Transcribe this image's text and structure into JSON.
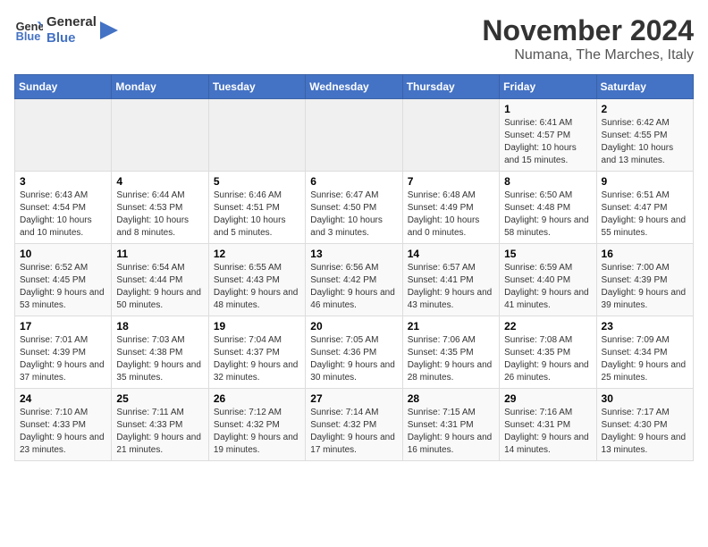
{
  "logo": {
    "line1": "General",
    "line2": "Blue"
  },
  "title": "November 2024",
  "location": "Numana, The Marches, Italy",
  "weekdays": [
    "Sunday",
    "Monday",
    "Tuesday",
    "Wednesday",
    "Thursday",
    "Friday",
    "Saturday"
  ],
  "weeks": [
    [
      {
        "day": "",
        "info": ""
      },
      {
        "day": "",
        "info": ""
      },
      {
        "day": "",
        "info": ""
      },
      {
        "day": "",
        "info": ""
      },
      {
        "day": "",
        "info": ""
      },
      {
        "day": "1",
        "info": "Sunrise: 6:41 AM\nSunset: 4:57 PM\nDaylight: 10 hours and 15 minutes."
      },
      {
        "day": "2",
        "info": "Sunrise: 6:42 AM\nSunset: 4:55 PM\nDaylight: 10 hours and 13 minutes."
      }
    ],
    [
      {
        "day": "3",
        "info": "Sunrise: 6:43 AM\nSunset: 4:54 PM\nDaylight: 10 hours and 10 minutes."
      },
      {
        "day": "4",
        "info": "Sunrise: 6:44 AM\nSunset: 4:53 PM\nDaylight: 10 hours and 8 minutes."
      },
      {
        "day": "5",
        "info": "Sunrise: 6:46 AM\nSunset: 4:51 PM\nDaylight: 10 hours and 5 minutes."
      },
      {
        "day": "6",
        "info": "Sunrise: 6:47 AM\nSunset: 4:50 PM\nDaylight: 10 hours and 3 minutes."
      },
      {
        "day": "7",
        "info": "Sunrise: 6:48 AM\nSunset: 4:49 PM\nDaylight: 10 hours and 0 minutes."
      },
      {
        "day": "8",
        "info": "Sunrise: 6:50 AM\nSunset: 4:48 PM\nDaylight: 9 hours and 58 minutes."
      },
      {
        "day": "9",
        "info": "Sunrise: 6:51 AM\nSunset: 4:47 PM\nDaylight: 9 hours and 55 minutes."
      }
    ],
    [
      {
        "day": "10",
        "info": "Sunrise: 6:52 AM\nSunset: 4:45 PM\nDaylight: 9 hours and 53 minutes."
      },
      {
        "day": "11",
        "info": "Sunrise: 6:54 AM\nSunset: 4:44 PM\nDaylight: 9 hours and 50 minutes."
      },
      {
        "day": "12",
        "info": "Sunrise: 6:55 AM\nSunset: 4:43 PM\nDaylight: 9 hours and 48 minutes."
      },
      {
        "day": "13",
        "info": "Sunrise: 6:56 AM\nSunset: 4:42 PM\nDaylight: 9 hours and 46 minutes."
      },
      {
        "day": "14",
        "info": "Sunrise: 6:57 AM\nSunset: 4:41 PM\nDaylight: 9 hours and 43 minutes."
      },
      {
        "day": "15",
        "info": "Sunrise: 6:59 AM\nSunset: 4:40 PM\nDaylight: 9 hours and 41 minutes."
      },
      {
        "day": "16",
        "info": "Sunrise: 7:00 AM\nSunset: 4:39 PM\nDaylight: 9 hours and 39 minutes."
      }
    ],
    [
      {
        "day": "17",
        "info": "Sunrise: 7:01 AM\nSunset: 4:39 PM\nDaylight: 9 hours and 37 minutes."
      },
      {
        "day": "18",
        "info": "Sunrise: 7:03 AM\nSunset: 4:38 PM\nDaylight: 9 hours and 35 minutes."
      },
      {
        "day": "19",
        "info": "Sunrise: 7:04 AM\nSunset: 4:37 PM\nDaylight: 9 hours and 32 minutes."
      },
      {
        "day": "20",
        "info": "Sunrise: 7:05 AM\nSunset: 4:36 PM\nDaylight: 9 hours and 30 minutes."
      },
      {
        "day": "21",
        "info": "Sunrise: 7:06 AM\nSunset: 4:35 PM\nDaylight: 9 hours and 28 minutes."
      },
      {
        "day": "22",
        "info": "Sunrise: 7:08 AM\nSunset: 4:35 PM\nDaylight: 9 hours and 26 minutes."
      },
      {
        "day": "23",
        "info": "Sunrise: 7:09 AM\nSunset: 4:34 PM\nDaylight: 9 hours and 25 minutes."
      }
    ],
    [
      {
        "day": "24",
        "info": "Sunrise: 7:10 AM\nSunset: 4:33 PM\nDaylight: 9 hours and 23 minutes."
      },
      {
        "day": "25",
        "info": "Sunrise: 7:11 AM\nSunset: 4:33 PM\nDaylight: 9 hours and 21 minutes."
      },
      {
        "day": "26",
        "info": "Sunrise: 7:12 AM\nSunset: 4:32 PM\nDaylight: 9 hours and 19 minutes."
      },
      {
        "day": "27",
        "info": "Sunrise: 7:14 AM\nSunset: 4:32 PM\nDaylight: 9 hours and 17 minutes."
      },
      {
        "day": "28",
        "info": "Sunrise: 7:15 AM\nSunset: 4:31 PM\nDaylight: 9 hours and 16 minutes."
      },
      {
        "day": "29",
        "info": "Sunrise: 7:16 AM\nSunset: 4:31 PM\nDaylight: 9 hours and 14 minutes."
      },
      {
        "day": "30",
        "info": "Sunrise: 7:17 AM\nSunset: 4:30 PM\nDaylight: 9 hours and 13 minutes."
      }
    ]
  ]
}
